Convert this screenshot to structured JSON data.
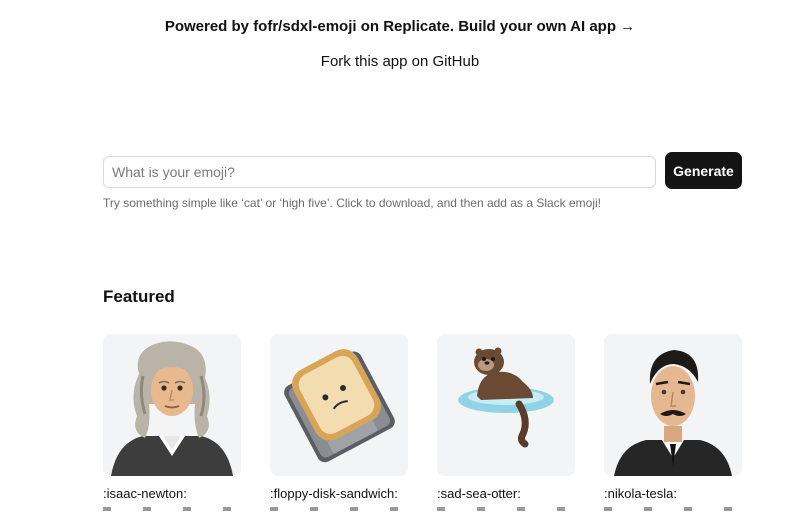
{
  "header": {
    "powered_text": "Powered by fofr/sdxl-emoji on Replicate. Build your own AI app →",
    "fork_text": "Fork this app on GitHub"
  },
  "search": {
    "placeholder": "What is your emoji?",
    "value": "",
    "button_label": "Generate",
    "hint": "Try something simple like ‘cat’ or ‘high five’. Click to download, and then add as a Slack emoji!"
  },
  "featured": {
    "heading": "Featured",
    "items": [
      {
        "label": ":isaac-newton:",
        "icon": "isaac-newton-emoji"
      },
      {
        "label": ":floppy-disk-sandwich:",
        "icon": "floppy-disk-sandwich-emoji"
      },
      {
        "label": ":sad-sea-otter:",
        "icon": "sad-sea-otter-emoji"
      },
      {
        "label": ":nikola-tesla:",
        "icon": "nikola-tesla-emoji"
      }
    ]
  },
  "colors": {
    "button_bg": "#141414",
    "card_bg": "#f3f4f5",
    "hint_text": "#6a6a6a"
  }
}
